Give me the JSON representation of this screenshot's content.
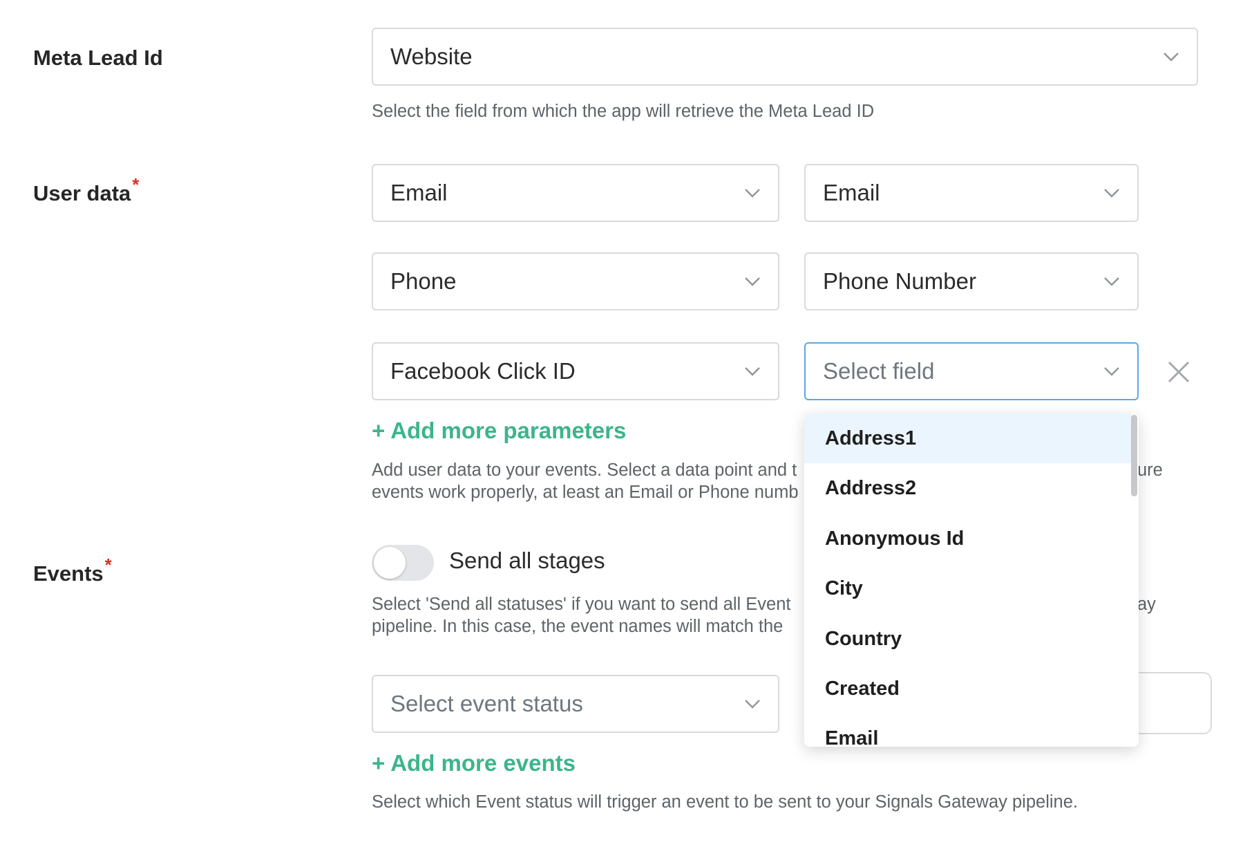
{
  "meta_lead": {
    "label": "Meta Lead Id",
    "value": "Website",
    "help": "Select the field from which the app will retrieve the Meta Lead ID"
  },
  "user_data": {
    "label": "User data",
    "required_mark": "*",
    "rows": [
      {
        "left": "Email",
        "right": "Email"
      },
      {
        "left": "Phone",
        "right": "Phone Number"
      },
      {
        "left": "Facebook Click ID",
        "right_placeholder": "Select field"
      }
    ],
    "add_link": "+ Add more parameters",
    "help_line1_start": "Add user data to your events. Select a data point and t",
    "help_line1_end": "ure",
    "help_line2_start": "events work properly, at least an Email or Phone numb"
  },
  "events": {
    "label": "Events",
    "required_mark": "*",
    "toggle_label": "Send all stages",
    "toggle_on": false,
    "help_line1_start": "Select 'Send all statuses' if you want to send all Event",
    "help_line1_end": "ay",
    "help_line2_start": "pipeline. In this case, the event names will match the",
    "status_placeholder": "Select event status",
    "add_link": "+ Add more events",
    "help_bottom": "Select which Event status will trigger an event to be sent to your Signals Gateway pipeline."
  },
  "dropdown": {
    "items": [
      "Address1",
      "Address2",
      "Anonymous Id",
      "City",
      "Country",
      "Created",
      "Email"
    ],
    "highlighted_index": 0
  },
  "colors": {
    "accent_link": "#3cb58a",
    "required": "#d93025",
    "focus_border": "#5aa7e6",
    "highlight_bg": "#ebf5fd"
  },
  "icons": {
    "chevron": "chevron-down-icon",
    "remove": "close-icon"
  }
}
